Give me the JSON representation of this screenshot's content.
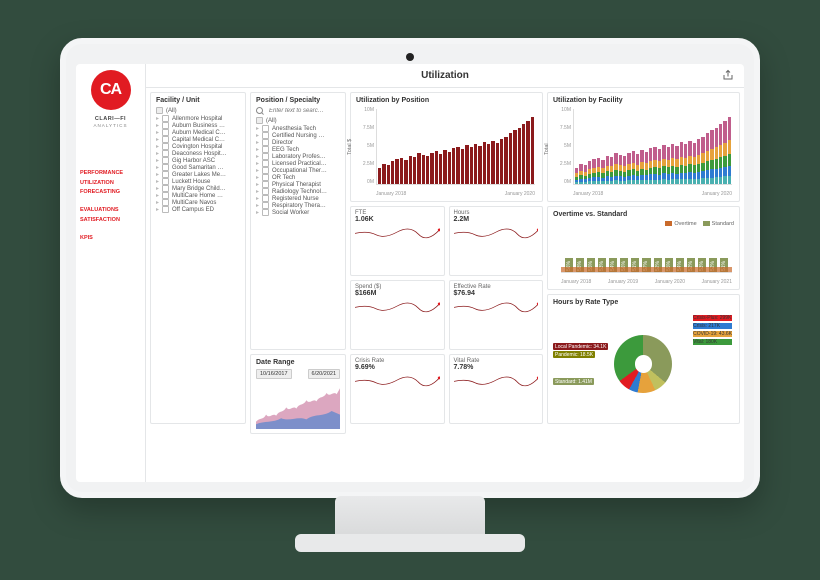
{
  "brand": {
    "logo_text": "CA",
    "name": "CLARI—FI",
    "sub": "ANALYTICS"
  },
  "nav": {
    "performance": "Performance",
    "utilization": "Utilization",
    "forecasting": "Forecasting",
    "evaluations": "Evaluations",
    "satisfaction": "Satisfaction",
    "kpis": "KPIs"
  },
  "page_title": "Utilization",
  "filters": {
    "facility": {
      "title": "Facility / Unit",
      "all": "(All)",
      "items": [
        "Allenmore Hospital",
        "Auburn Business …",
        "Auburn Medical C…",
        "Capital Medical C…",
        "Covington Hospital",
        "Deaconess Hospit…",
        "Gig Harbor ASC",
        "Good Samaritan …",
        "Greater Lakes Me…",
        "Luckett House",
        "Mary Bridge Child…",
        "MultiCare Home …",
        "MultiCare Navos",
        "Off Campus ED"
      ]
    },
    "position": {
      "title": "Position / Specialty",
      "search_placeholder": "Enter text to searc…",
      "all": "(All)",
      "items": [
        "Anesthesia Tech",
        "Certified Nursing …",
        "Director",
        "EEG Tech",
        "Laboratory Profes…",
        "Licensed Practical…",
        "Occupational Ther…",
        "OR Tech",
        "Physical Therapist",
        "Radiology Technol…",
        "Registered Nurse",
        "Respiratory Thera…",
        "Social Worker"
      ]
    }
  },
  "date_range": {
    "title": "Date Range",
    "from": "10/16/2017",
    "to": "6/20/2021"
  },
  "chart_data": {
    "util_by_position": {
      "type": "bar",
      "title": "Utilization by Position",
      "ylabel": "Total $",
      "yticks": [
        "10M",
        "7.5M",
        "5M",
        "2.5M",
        "0M"
      ],
      "xticks": [
        "January 2018",
        "January 2020"
      ],
      "values": [
        2.2,
        2.7,
        2.5,
        3.1,
        3.3,
        3.5,
        3.2,
        3.8,
        3.6,
        4.1,
        3.9,
        3.7,
        4.2,
        4.4,
        4.0,
        4.6,
        4.3,
        4.8,
        5.0,
        4.7,
        5.2,
        4.9,
        5.4,
        5.1,
        5.6,
        5.3,
        5.8,
        5.5,
        6.0,
        6.3,
        6.8,
        7.2,
        7.5,
        8.0,
        8.4,
        9.0
      ]
    },
    "util_by_facility": {
      "type": "bar",
      "title": "Utilization by Facility",
      "ylabel": "Total",
      "yticks": [
        "10M",
        "7.5M",
        "5M",
        "2.5M",
        "0M"
      ],
      "xticks": [
        "January 2018",
        "January 2020"
      ],
      "series_colors": [
        "#c05e8c",
        "#e6a23c",
        "#3c9a3c",
        "#2f7bd1",
        "#49b0b0"
      ],
      "values": [
        2.2,
        2.7,
        2.5,
        3.1,
        3.3,
        3.5,
        3.2,
        3.8,
        3.6,
        4.1,
        3.9,
        3.7,
        4.2,
        4.4,
        4.0,
        4.6,
        4.3,
        4.8,
        5.0,
        4.7,
        5.2,
        4.9,
        5.4,
        5.1,
        5.6,
        5.3,
        5.8,
        5.5,
        6.0,
        6.3,
        6.8,
        7.2,
        7.5,
        8.0,
        8.4,
        9.0
      ]
    },
    "kpis": [
      {
        "label": "FTE",
        "value": "1.06K"
      },
      {
        "label": "Hours",
        "value": "2.2M"
      },
      {
        "label": "Spend ($)",
        "value": "$166M"
      },
      {
        "label": "Effective Rate",
        "value": "$76.94"
      },
      {
        "label": "Crisis Rate",
        "value": "9.69%"
      },
      {
        "label": "Vital Rate",
        "value": "7.78%"
      }
    ],
    "overtime": {
      "type": "bar",
      "title": "Overtime vs. Standard",
      "legend": {
        "a": "Overtime",
        "b": "Standard"
      },
      "ylim": [
        0,
        100
      ],
      "xticks": [
        "January 2018",
        "January 2019",
        "January 2020",
        "January 2021"
      ],
      "pct": [
        "56%",
        "58%",
        "55%",
        "53%",
        "54%",
        "56%",
        "51%",
        "57%",
        "52%",
        "55%",
        "54%",
        "52%",
        "53%",
        "52%",
        "51%"
      ]
    },
    "hours_by_rate": {
      "type": "pie",
      "title": "Hours by Rate Type",
      "slices": [
        {
          "name": "Local Pandemic",
          "value": "34.1K",
          "color": "#8b1a1c"
        },
        {
          "name": "Pandemic",
          "value": "18.5K",
          "color": "#808000"
        },
        {
          "name": "Standard",
          "value": "1.41M",
          "color": "#8a9a5b"
        },
        {
          "name": "Crisis-Plus",
          "value": "299K",
          "color": "#e11b22"
        },
        {
          "name": "Crisis",
          "value": "217K",
          "color": "#2f7bd1"
        },
        {
          "name": "COVID-19",
          "value": "43.6K",
          "color": "#e6a23c"
        },
        {
          "name": "Vital",
          "value": "180K",
          "color": "#3c9a3c"
        }
      ]
    }
  }
}
